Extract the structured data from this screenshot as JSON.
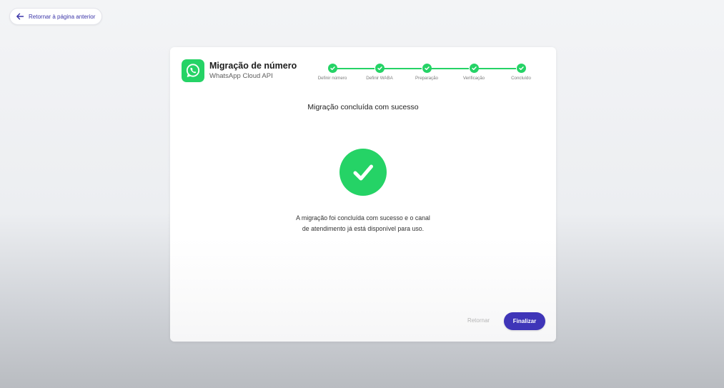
{
  "back_link": {
    "label": "Retornar à página anterior",
    "icon": "arrow-left-icon"
  },
  "card": {
    "logo_icon": "whatsapp-icon",
    "title": "Migração de número",
    "subtitle": "WhatsApp Cloud API",
    "steps": [
      {
        "label": "Definir número",
        "status": "done"
      },
      {
        "label": "Definir WABA",
        "status": "done"
      },
      {
        "label": "Preparação",
        "status": "done"
      },
      {
        "label": "Verificação",
        "status": "done"
      },
      {
        "label": "Concluído",
        "status": "done"
      }
    ],
    "heading": "Migração concluída com sucesso",
    "success_icon": "check-circle-icon",
    "message_line1": "A migração foi concluída com sucesso e o canal",
    "message_line2": "de atendimento já está disponível para uso.",
    "buttons": {
      "back_label": "Retornar",
      "finish_label": "Finalizar"
    }
  },
  "colors": {
    "accent": "#25d366",
    "primary_button": "#3f35b8",
    "link": "#3b35a8"
  }
}
